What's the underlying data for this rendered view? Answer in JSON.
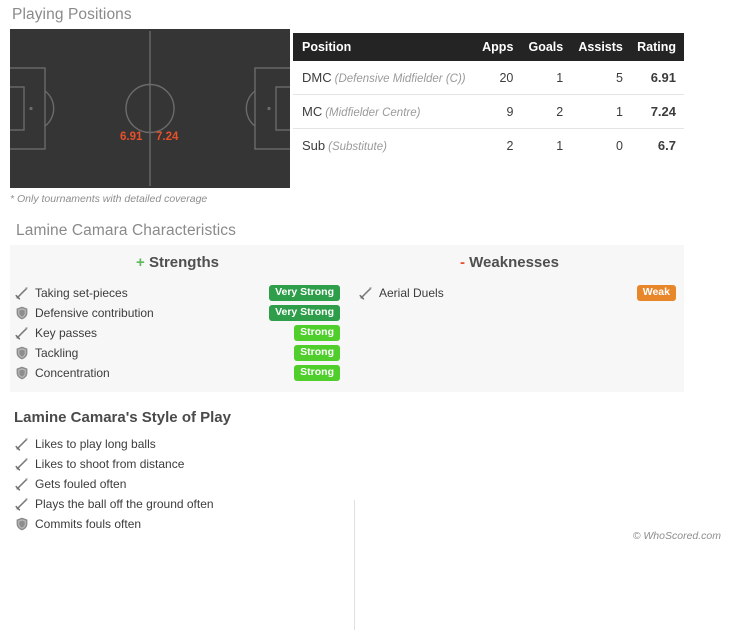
{
  "playing_positions": {
    "title": "Playing Positions",
    "footnote": "* Only tournaments with detailed coverage",
    "pitch_ratings": [
      "6.91",
      "7.24"
    ],
    "rating_color": "#e8502a",
    "pitch_bg": "#353535",
    "pitch_line": "#6b6b6b",
    "table": {
      "columns": [
        "Position",
        "Apps",
        "Goals",
        "Assists",
        "Rating"
      ],
      "rows": [
        {
          "abbr": "DMC",
          "full": "(Defensive Midfielder (C))",
          "apps": "20",
          "goals": "1",
          "assists": "5",
          "rating": "6.91"
        },
        {
          "abbr": "MC",
          "full": "(Midfielder Centre)",
          "apps": "9",
          "goals": "2",
          "assists": "1",
          "rating": "7.24"
        },
        {
          "abbr": "Sub",
          "full": "(Substitute)",
          "apps": "2",
          "goals": "1",
          "assists": "0",
          "rating": "6.7"
        }
      ]
    }
  },
  "characteristics": {
    "title": "Lamine Camara Characteristics",
    "strengths_sign": "+",
    "strengths_head": "Strengths",
    "weaknesses_sign": "-",
    "weaknesses_head": "Weaknesses",
    "strengths": [
      {
        "icon": "sword-icon",
        "label": "Taking set-pieces",
        "badge": "Very Strong",
        "badge_class": "badge-very-strong"
      },
      {
        "icon": "shield-icon",
        "label": "Defensive contribution",
        "badge": "Very Strong",
        "badge_class": "badge-very-strong"
      },
      {
        "icon": "sword-icon",
        "label": "Key passes",
        "badge": "Strong",
        "badge_class": "badge-strong"
      },
      {
        "icon": "shield-icon",
        "label": "Tackling",
        "badge": "Strong",
        "badge_class": "badge-strong"
      },
      {
        "icon": "shield-icon",
        "label": "Concentration",
        "badge": "Strong",
        "badge_class": "badge-strong"
      }
    ],
    "weaknesses": [
      {
        "icon": "sword-icon",
        "label": "Aerial Duels",
        "badge": "Weak",
        "badge_class": "badge-weak"
      }
    ],
    "badge_colors": {
      "very_strong": "#2e9e4a",
      "strong": "#4fce2c",
      "weak": "#e8862a"
    }
  },
  "style_of_play": {
    "title": "Lamine Camara's Style of Play",
    "items": [
      {
        "icon": "sword-icon",
        "label": "Likes to play long balls"
      },
      {
        "icon": "sword-icon",
        "label": "Likes to shoot from distance"
      },
      {
        "icon": "sword-icon",
        "label": "Gets fouled often"
      },
      {
        "icon": "sword-icon",
        "label": "Plays the ball off the ground often"
      },
      {
        "icon": "shield-icon",
        "label": "Commits fouls often"
      }
    ]
  },
  "footer": {
    "credit": "© WhoScored.com"
  }
}
